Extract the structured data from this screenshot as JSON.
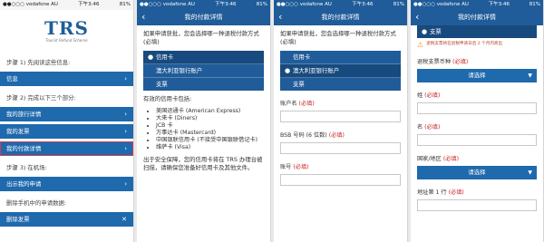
{
  "status": {
    "carrier": "●●○○○ vodafone AU",
    "time": "下午3:46",
    "battery": "81%"
  },
  "screen1": {
    "logo_main": "TRS",
    "logo_sub": "Tourist Refund Scheme",
    "step1": "步骤 1) 先阅读这些信息:",
    "info": "信息",
    "step2": "步骤 2) 完成以下三个部分:",
    "travel": "我的旅行详情",
    "invoices": "我的发票",
    "payment": "我的付款详情",
    "step3": "步骤 3) 在机场:",
    "show": "出示我的申请",
    "delete_label": "删除手机中的申请数据:",
    "delete_btn": "删除发票"
  },
  "screen2": {
    "title": "我的付款详情",
    "intro": "如果申请获批，您会选择哪一种退税付款方式 (必填)",
    "opt_card": "信用卡",
    "opt_bank": "澳大利亚银行账户",
    "opt_cheque": "支票",
    "valid_cards": "有效的信用卡包括:",
    "cards": [
      "美国运通卡 (American Express)",
      "大来卡 (Diners)",
      "JCB 卡",
      "万事达卡 (Mastercard)",
      "中国银联信用卡 (不接受中国银联借记卡)",
      "维萨卡 (Visa)"
    ],
    "note": "出于安全保障，您的信用卡将在 TRS 办理台被扫描，请确保您准备好信用卡及其他文件。"
  },
  "screen3": {
    "title": "我的付款详情",
    "intro": "如果申请获批，您会选择哪一种退税付款方式 (必填)",
    "opt_card": "信用卡",
    "opt_bank": "澳大利亚银行账户",
    "opt_cheque": "支票",
    "account_name": "账户名",
    "bsb": "BSB 号码 (6 位数)",
    "account_no": "账号",
    "req": "(必填)"
  },
  "screen4": {
    "title": "我的付款详情",
    "opt_cheque": "支票",
    "warning": "退税支票将在退税申请日后 2 个月内寄出",
    "currency": "退税支票币种",
    "select": "请选择",
    "surname": "姓",
    "given": "名",
    "country": "国家/地区",
    "address": "地址第 1 行",
    "req": "(必填)"
  },
  "colors": {
    "primary": "#1f69ad",
    "nav": "#1f5c99",
    "required": "#c62020",
    "highlight": "#d43a4e"
  }
}
